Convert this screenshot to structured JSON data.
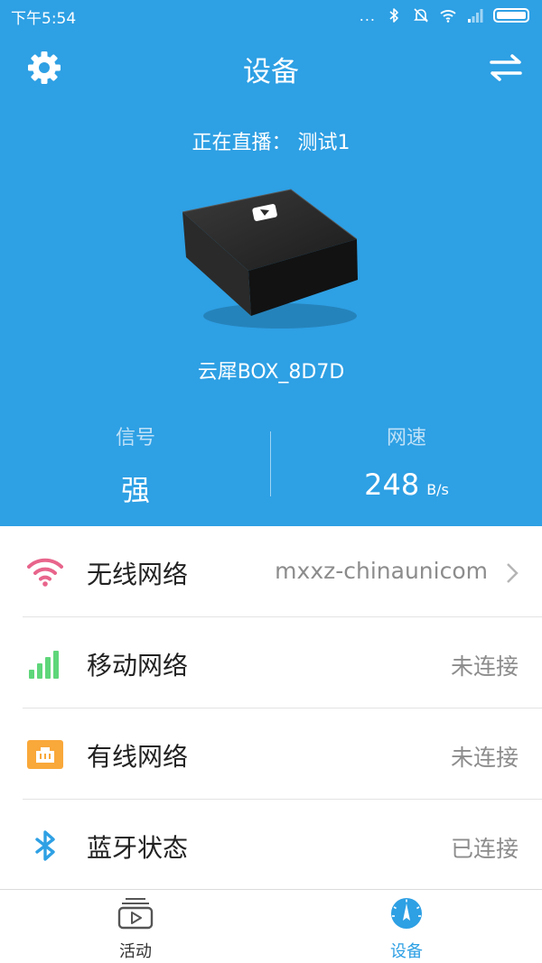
{
  "status_bar": {
    "time": "下午5:54",
    "dots": "...",
    "icons": [
      "bluetooth-icon",
      "mute-icon",
      "wifi-icon",
      "cell-signal-icon",
      "battery-icon"
    ]
  },
  "header": {
    "title": "设备",
    "left_icon": "gear-icon",
    "right_icon": "switch-arrows-icon"
  },
  "live": {
    "label": "正在直播：",
    "name": "测试1"
  },
  "device": {
    "name": "云犀BOX_8D7D"
  },
  "stats": {
    "signal_label": "信号",
    "signal_value": "强",
    "speed_label": "网速",
    "speed_value": "248",
    "speed_unit": "B/s"
  },
  "network_list": [
    {
      "label": "无线网络",
      "value": "mxxz-chinaunicom",
      "icon": "wifi-icon",
      "icon_color": "#e8658c"
    },
    {
      "label": "移动网络",
      "value": "未连接",
      "icon": "cell-signal-icon",
      "icon_color": "#5fd67a"
    },
    {
      "label": "有线网络",
      "value": "未连接",
      "icon": "ethernet-icon",
      "icon_color": "#f9a83a"
    },
    {
      "label": "蓝牙状态",
      "value": "已连接",
      "icon": "bluetooth-icon",
      "icon_color": "#2ea0e4"
    }
  ],
  "tabbar": {
    "tabs": [
      {
        "label": "活动",
        "icon": "activity-icon",
        "active": false
      },
      {
        "label": "设备",
        "icon": "device-gauge-icon",
        "active": true
      }
    ]
  },
  "colors": {
    "primary": "#2ea0e4",
    "wifi": "#e8658c",
    "cellular": "#5fd67a",
    "ethernet": "#f9a83a",
    "bluetooth": "#2ea0e4"
  }
}
